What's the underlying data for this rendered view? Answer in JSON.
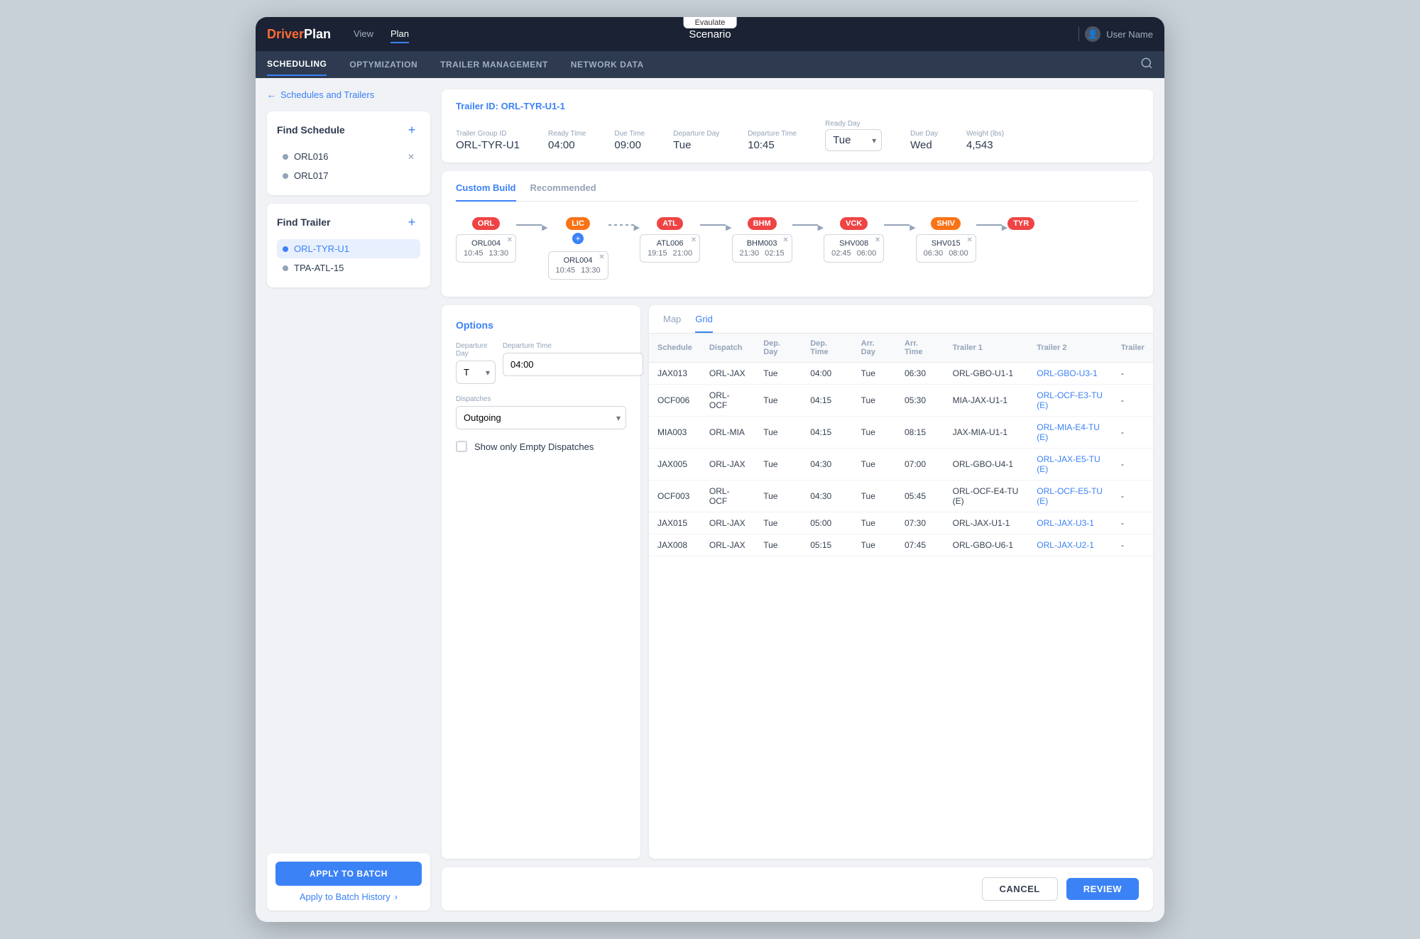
{
  "app": {
    "logo_driver": "Driver",
    "logo_plan": "Plan",
    "evaluate_tab": "Evaulate",
    "nav_title": "Scenario",
    "user_label": "User Name"
  },
  "top_nav": {
    "items": [
      {
        "label": "View",
        "active": false
      },
      {
        "label": "Plan",
        "active": true
      }
    ]
  },
  "nav_bar": {
    "items": [
      {
        "label": "SCHEDULING",
        "active": true
      },
      {
        "label": "OPTYMIZATION",
        "active": false
      },
      {
        "label": "TRAILER MANAGEMENT",
        "active": false
      },
      {
        "label": "NETWORK DATA",
        "active": false
      }
    ]
  },
  "sidebar": {
    "back_label": "Schedules and Trailers",
    "find_schedule": {
      "title": "Find Schedule",
      "items": [
        {
          "label": "ORL016",
          "active": false
        },
        {
          "label": "ORL017",
          "active": false
        }
      ]
    },
    "find_trailer": {
      "title": "Find Trailer",
      "items": [
        {
          "label": "ORL-TYR-U1",
          "active": true
        },
        {
          "label": "TPA-ATL-15",
          "active": false
        }
      ]
    },
    "apply_batch_label": "APPLY TO BATCH",
    "apply_history_label": "Apply to Batch History"
  },
  "trailer_header": {
    "id_label": "Trailer ID: ORL-TYR-U1-1",
    "fields": {
      "trailer_group_label": "Trailer Group ID",
      "trailer_group_value": "ORL-TYR-U1",
      "ready_time_label": "Ready Time",
      "ready_time_value": "04:00",
      "due_time_label": "Due Time",
      "due_time_value": "09:00",
      "departure_day_label": "Departure Day",
      "departure_day_value": "Tue",
      "departure_time_label": "Departure Time",
      "departure_time_value": "10:45",
      "ready_day_label": "Ready Day",
      "ready_day_value": "Tue",
      "due_day_label": "Due Day",
      "due_day_value": "Wed",
      "weight_label": "Weight (lbs)",
      "weight_value": "4,543"
    }
  },
  "tabs": {
    "custom_build": "Custom Build",
    "recommended": "Recommended"
  },
  "route": {
    "nodes": [
      {
        "badge": "ORL",
        "badge_class": "badge-orl",
        "schedule_id": "ORL004",
        "times": [
          "10:45",
          "13:30"
        ],
        "connector": "arrow",
        "connector_style": "solid"
      },
      {
        "badge": "LIC",
        "badge_class": "badge-lic",
        "has_plus": true,
        "schedule_id": "ORL004",
        "times": [
          "10:45",
          "13:30"
        ],
        "connector": "arrow",
        "connector_style": "dashed"
      },
      {
        "badge": "ATL",
        "badge_class": "badge-atl",
        "schedule_id": "ATL006",
        "times": [
          "19:15",
          "21:00"
        ],
        "connector": "arrow",
        "connector_style": "solid"
      },
      {
        "badge": "BHM",
        "badge_class": "badge-bhm",
        "schedule_id": "BHM003",
        "times": [
          "21:30",
          "02:15"
        ],
        "connector": "arrow",
        "connector_style": "solid"
      },
      {
        "badge": "VCK",
        "badge_class": "badge-vck",
        "schedule_id": "SHV008",
        "times": [
          "02:45",
          "06:00"
        ],
        "connector": "arrow",
        "connector_style": "solid"
      },
      {
        "badge": "SHIV",
        "badge_class": "badge-shiv",
        "schedule_id": "SHV015",
        "times": [
          "06:30",
          "08:00"
        ],
        "connector": "arrow",
        "connector_style": "solid"
      },
      {
        "badge": "TYR",
        "badge_class": "badge-tyr",
        "schedule_id": null,
        "times": [],
        "connector": null
      }
    ]
  },
  "options": {
    "title": "Options",
    "departure_day_label": "Departure Day",
    "departure_day_value": "T",
    "departure_time_label": "Departure Time",
    "departure_time_value": "04:00",
    "dispatches_label": "Dispatches",
    "dispatches_value": "Outgoing",
    "show_empty_label": "Show only Empty Dispatches"
  },
  "grid": {
    "tabs": [
      "Map",
      "Grid"
    ],
    "active_tab": "Grid",
    "columns": [
      "Schedule",
      "Dispatch",
      "Dep. Day",
      "Dep. Time",
      "Arr. Day",
      "Arr. Time",
      "Trailer 1",
      "Trailer 2",
      "Trailer"
    ],
    "rows": [
      {
        "schedule": "JAX013",
        "dispatch": "ORL-JAX",
        "dep_day": "Tue",
        "dep_time": "04:00",
        "arr_day": "Tue",
        "arr_time": "06:30",
        "trailer1": "ORL-GBO-U1-1",
        "trailer2": "ORL-GBO-U3-1",
        "trailer3": "-"
      },
      {
        "schedule": "OCF006",
        "dispatch": "ORL-OCF",
        "dep_day": "Tue",
        "dep_time": "04:15",
        "arr_day": "Tue",
        "arr_time": "05:30",
        "trailer1": "MIA-JAX-U1-1",
        "trailer2": "ORL-OCF-E3-TU (E)",
        "trailer3": "-"
      },
      {
        "schedule": "MIA003",
        "dispatch": "ORL-MIA",
        "dep_day": "Tue",
        "dep_time": "04:15",
        "arr_day": "Tue",
        "arr_time": "08:15",
        "trailer1": "JAX-MIA-U1-1",
        "trailer2": "ORL-MIA-E4-TU (E)",
        "trailer3": "-"
      },
      {
        "schedule": "JAX005",
        "dispatch": "ORL-JAX",
        "dep_day": "Tue",
        "dep_time": "04:30",
        "arr_day": "Tue",
        "arr_time": "07:00",
        "trailer1": "ORL-GBO-U4-1",
        "trailer2": "ORL-JAX-E5-TU (E)",
        "trailer3": "-"
      },
      {
        "schedule": "OCF003",
        "dispatch": "ORL-OCF",
        "dep_day": "Tue",
        "dep_time": "04:30",
        "arr_day": "Tue",
        "arr_time": "05:45",
        "trailer1": "ORL-OCF-E4-TU (E)",
        "trailer2": "ORL-OCF-E5-TU (E)",
        "trailer3": "-"
      },
      {
        "schedule": "JAX015",
        "dispatch": "ORL-JAX",
        "dep_day": "Tue",
        "dep_time": "05:00",
        "arr_day": "Tue",
        "arr_time": "07:30",
        "trailer1": "ORL-JAX-U1-1",
        "trailer2": "ORL-JAX-U3-1",
        "trailer3": "-"
      },
      {
        "schedule": "JAX008",
        "dispatch": "ORL-JAX",
        "dep_day": "Tue",
        "dep_time": "05:15",
        "arr_day": "Tue",
        "arr_time": "07:45",
        "trailer1": "ORL-GBO-U6-1",
        "trailer2": "ORL-JAX-U2-1",
        "trailer3": "-"
      }
    ]
  },
  "footer": {
    "cancel_label": "CANCEL",
    "review_label": "REVIEW"
  }
}
